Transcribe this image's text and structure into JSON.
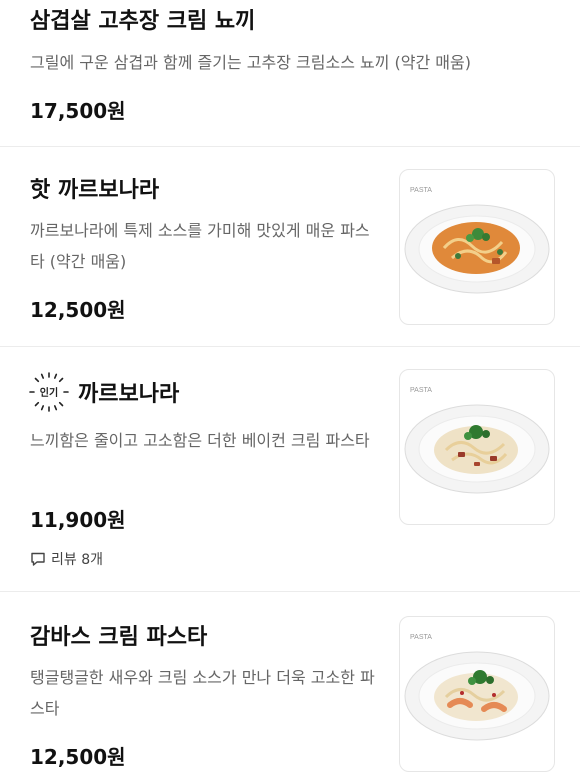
{
  "menu": [
    {
      "name": "삼겹살 고추장 크림 뇨끼",
      "description": "그릴에 구운 삼겹과 함께 즐기는 고추장 크림소스 뇨끼 (약간 매움)",
      "price": "17,500원"
    },
    {
      "name": "핫 까르보나라",
      "description": "까르보나라에 특제 소스를 가미해 맛있게 매운 파스타 (약간 매움)",
      "price": "12,500원",
      "image_icon": "pasta-plate-icon"
    },
    {
      "badge": "인기",
      "name": "까르보나라",
      "description": "느끼함은 줄이고 고소함은 더한 베이컨 크림 파스타",
      "price": "11,900원",
      "review": "리뷰 8개",
      "image_icon": "pasta-plate-icon"
    },
    {
      "name": "감바스 크림 파스타",
      "description": "탱글탱글한 새우와 크림 소스가 만나 더욱 고소한 파스타",
      "price": "12,500원",
      "image_icon": "pasta-plate-icon"
    }
  ],
  "colors": {
    "text": "#111111",
    "description": "#666666",
    "divider": "#ececec",
    "sauce_spicy": "#e0893a",
    "sauce_cream": "#efe2c6"
  }
}
